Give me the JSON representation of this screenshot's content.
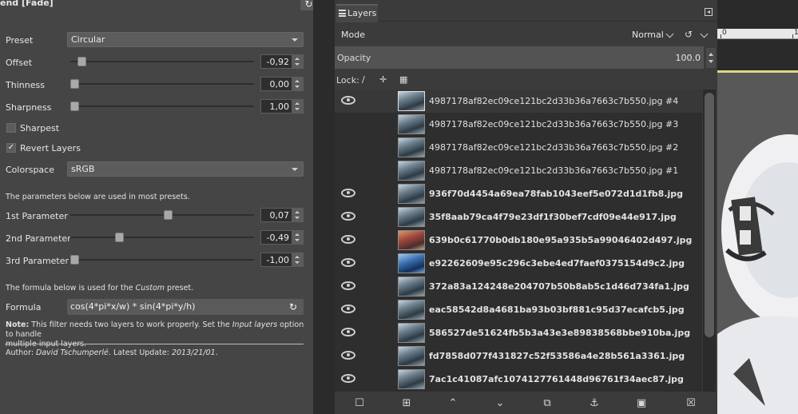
{
  "filter": {
    "title": "end [Fade]",
    "preset": {
      "label": "Preset",
      "value": "Circular"
    },
    "offset": {
      "label": "Offset",
      "value": "-0,92",
      "level": 0.04
    },
    "thinness": {
      "label": "Thinness",
      "value": "0,00",
      "level": 0.0
    },
    "sharpness": {
      "label": "Sharpness",
      "value": "1,00",
      "level": 0.0
    },
    "sharpest": {
      "label": "Sharpest",
      "checked": false
    },
    "revert_layers": {
      "label": "Revert Layers",
      "checked": true
    },
    "colorspace": {
      "label": "Colorspace",
      "value": "sRGB"
    },
    "params_note": "The parameters below are used in most presets.",
    "param1": {
      "label": "1st Parameter",
      "value": "0,07",
      "level": 0.535
    },
    "param2": {
      "label": "2nd Parameter",
      "value": "-0,49",
      "level": 0.255
    },
    "param3": {
      "label": "3rd Parameter",
      "value": "-1,00",
      "level": 0.0
    },
    "formula_note_prefix": "The formula below is used for the ",
    "formula_note_italic": "Custom",
    "formula_note_suffix": " preset.",
    "formula": {
      "label": "Formula",
      "value": "cos(4*pi*x/w) * sin(4*pi*y/h)"
    },
    "note_bold": "Note:",
    "note_text1": " This filter needs two layers to work properly. Set the ",
    "note_italic": "Input layers",
    "note_text2": " option to handle",
    "note_line2": "multiple input layers.",
    "author_prefix": "Author: ",
    "author_name": "David Tschumperlé",
    "author_mid": ". Latest Update: ",
    "author_date": "2013/21/01",
    "author_end": "."
  },
  "layers_panel": {
    "tab_label": "Layers",
    "mode_label": "Mode",
    "mode_value": "Normal",
    "opacity_label": "Opacity",
    "opacity_value": "100.0",
    "lock_label": "Lock:",
    "layers": [
      {
        "name": "4987178af82ec09ce121bc2d33b36a7663c7b550.jpg #4",
        "visible": true,
        "bold": false,
        "selected": true
      },
      {
        "name": "4987178af82ec09ce121bc2d33b36a7663c7b550.jpg #3",
        "visible": false,
        "bold": false,
        "selected": false
      },
      {
        "name": "4987178af82ec09ce121bc2d33b36a7663c7b550.jpg #2",
        "visible": false,
        "bold": false,
        "selected": false
      },
      {
        "name": "4987178af82ec09ce121bc2d33b36a7663c7b550.jpg #1",
        "visible": false,
        "bold": false,
        "selected": false
      },
      {
        "name": "936f70d4454a69ea78fab1043eef5e072d1d1fb8.jpg",
        "visible": true,
        "bold": true,
        "selected": false
      },
      {
        "name": "35f8aab79ca4f79e23df1f30bef7cdf09e44e917.jpg",
        "visible": true,
        "bold": true,
        "selected": false
      },
      {
        "name": "639b0c61770b0db180e95a935b5a99046402d497.jpg",
        "visible": true,
        "bold": true,
        "selected": false
      },
      {
        "name": "e92262609e95c296c3ebe4ed7faef0375154d9c2.jpg",
        "visible": true,
        "bold": true,
        "selected": false
      },
      {
        "name": "372a83a124248e204707b50b8ab5c1d46d734fa1.jpg",
        "visible": true,
        "bold": true,
        "selected": false
      },
      {
        "name": "eac58542d8a4681ba93b03bf881c95d37ecafcb5.jpg",
        "visible": true,
        "bold": true,
        "selected": false
      },
      {
        "name": "586527de51624fb5b3a43e3e89838568bbe910ba.jpg",
        "visible": true,
        "bold": true,
        "selected": false
      },
      {
        "name": "fd7858d077f431827c52f53586a4e28b561a3361.jpg",
        "visible": true,
        "bold": true,
        "selected": false
      },
      {
        "name": "7ac1c41087afc1074127761448d96761f34aec87.jpg",
        "visible": true,
        "bold": true,
        "selected": false
      }
    ]
  },
  "ruler": {
    "tick1": "0",
    "tick2": "1"
  }
}
